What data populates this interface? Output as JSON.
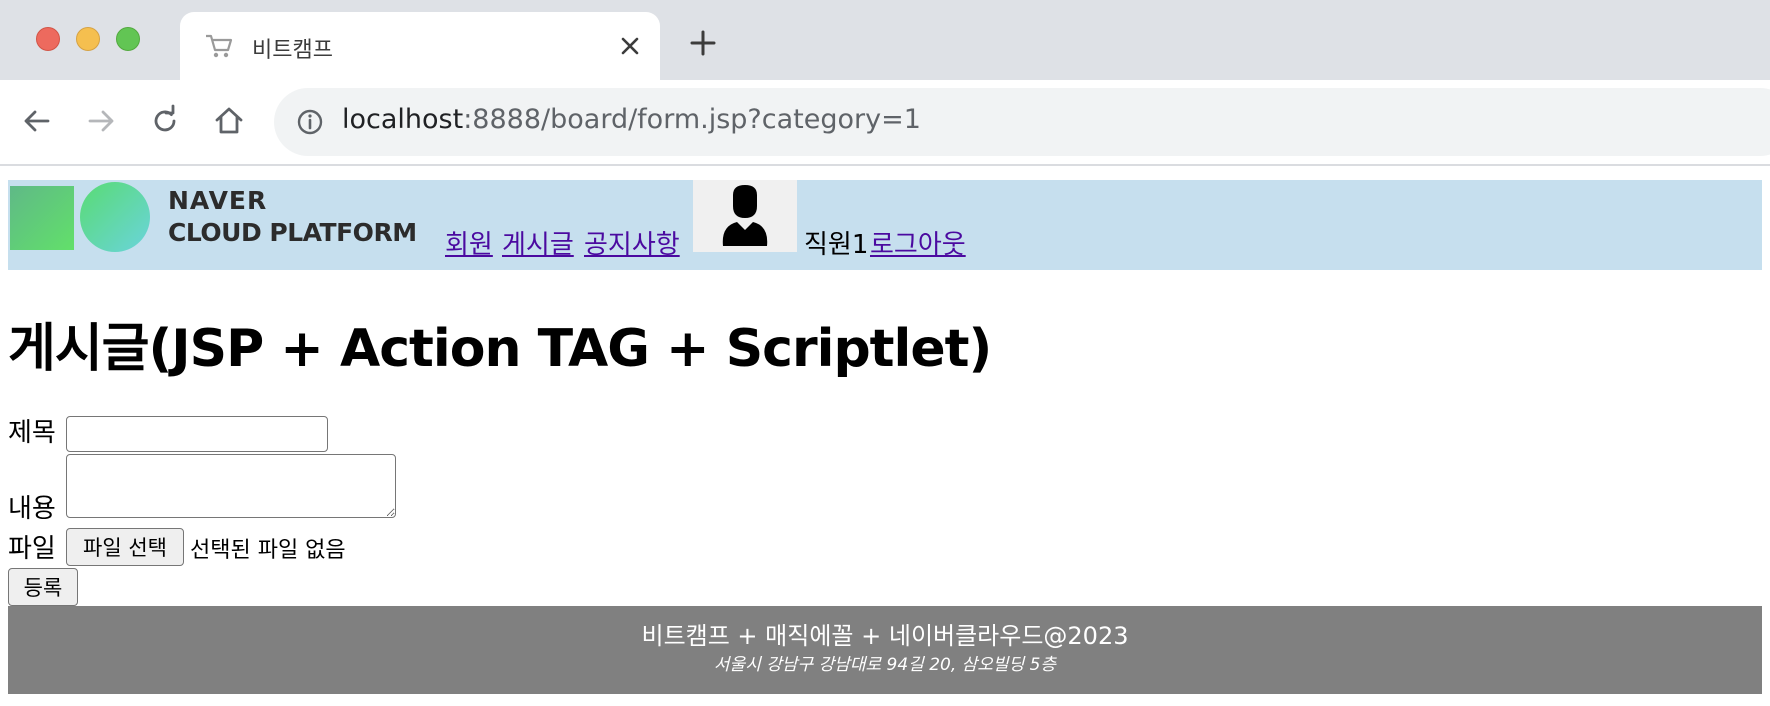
{
  "browser": {
    "tab_title": "비트캠프",
    "url_host": "localhost",
    "url_rest": ":8888/board/form.jsp?category=1"
  },
  "header": {
    "logo_line1": "NAVER",
    "logo_line2": "CLOUD PLATFORM",
    "menu": {
      "members": "회원",
      "board": "게시글",
      "notice": "공지사항"
    },
    "user_name": "직원1",
    "logout": "로그아웃"
  },
  "main": {
    "title": "게시글(JSP + Action TAG + Scriptlet)",
    "form": {
      "title_label": "제목",
      "title_value": "",
      "content_label": "내용",
      "content_value": "",
      "file_label": "파일",
      "file_button": "파일 선택",
      "file_status": "선택된 파일 없음",
      "submit": "등록"
    }
  },
  "footer": {
    "main": "비트캠프 + 매직에꼴 + 네이버클라우드@2023",
    "address": "서울시 강남구 강남대로 94길 20, 삼오빌딩 5층"
  },
  "colors": {
    "header_bg": "#c6dfee",
    "footer_bg": "#808080",
    "link": "#4b0aa0"
  },
  "icons": [
    "close-window-icon",
    "minimize-window-icon",
    "maximize-window-icon",
    "cart-icon",
    "close-tab-icon",
    "new-tab-icon",
    "back-icon",
    "forward-icon",
    "reload-icon",
    "home-icon",
    "info-icon",
    "user-avatar-icon"
  ]
}
